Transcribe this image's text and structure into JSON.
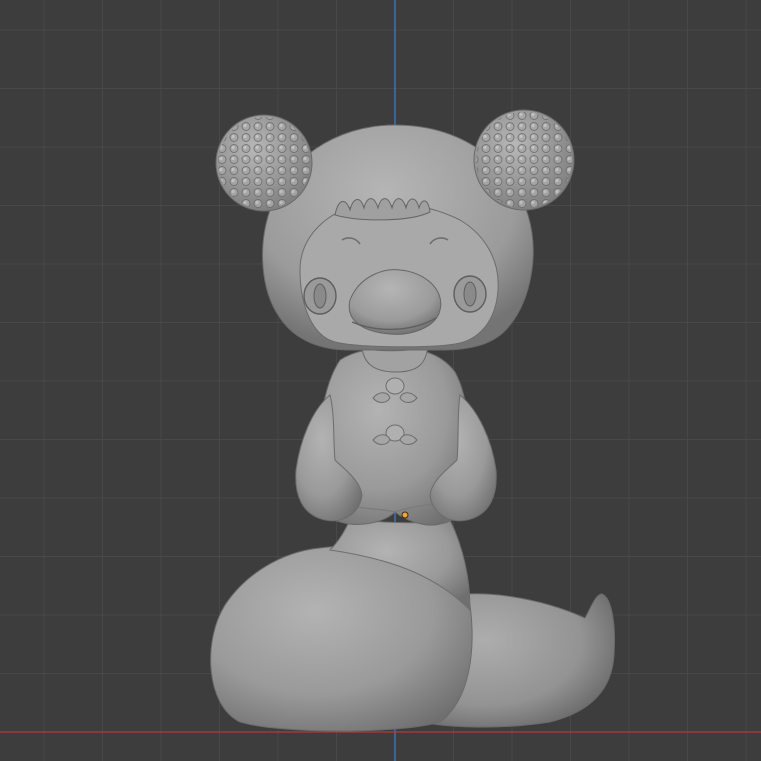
{
  "viewport": {
    "mode": "front-orthographic",
    "background_color": "#3d3d3d",
    "grid_color": "#4a4a4a",
    "z_axis_color": "#3f7fd0",
    "x_axis_color": "#b53a3a",
    "object_origin_color": "#f2a33a",
    "model_color": "#9e9e9e"
  },
  "model": {
    "description_icon": "snake-figure-sculpt",
    "shading": "solid-matcap"
  }
}
